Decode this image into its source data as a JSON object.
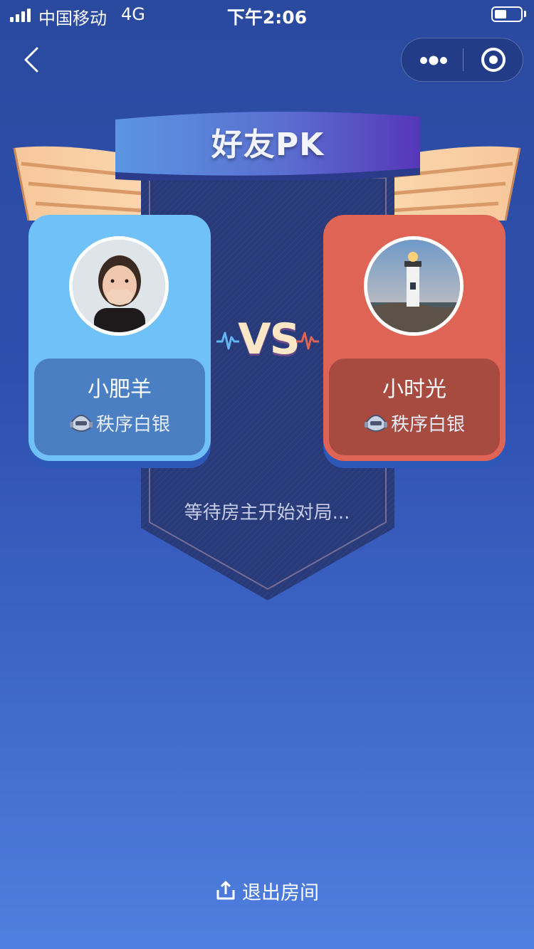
{
  "status_bar": {
    "carrier": "中国移动",
    "network": "4G",
    "time": "下午2:06"
  },
  "nav": {
    "back_icon": "chevron-left-icon",
    "more_icon": "more-dots-icon",
    "close_icon": "target-circle-icon"
  },
  "header": {
    "title": "好友PK"
  },
  "players": {
    "left": {
      "name": "小肥羊",
      "rank": "秩序白银",
      "rank_icon": "silver-rank-badge-icon",
      "card_color": "#6fc1f7"
    },
    "right": {
      "name": "小时光",
      "rank": "秩序白银",
      "rank_icon": "silver-rank-badge-icon",
      "card_color": "#e06455"
    }
  },
  "vs": {
    "label": "VS"
  },
  "status_message": "等待房主开始对局...",
  "footer": {
    "exit_label": "退出房间",
    "exit_icon": "share-upload-icon"
  },
  "colors": {
    "background_top": "#2a4aa0",
    "background_bottom": "#4f7fe0",
    "banner_left": "#5a8fe0",
    "banner_right": "#5a3cc0",
    "vs_text": "#fbe6c6"
  }
}
